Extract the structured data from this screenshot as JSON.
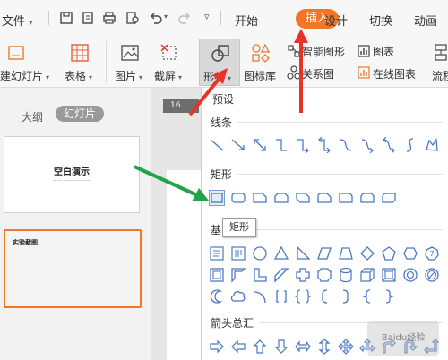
{
  "menubar": {
    "file_label": "文件",
    "tabs": [
      "开始",
      "插入",
      "设计",
      "切换",
      "动画"
    ],
    "active_tab": "插入"
  },
  "ribbon": {
    "new_slide_label": "建幻灯片",
    "table_label": "表格",
    "picture_label": "图片",
    "screenshot_label": "截屏",
    "shape_label": "形状",
    "icon_lib_label": "图标库",
    "smart_art_label": "智能图形",
    "relation_label": "关系图",
    "chart_label": "图表",
    "online_chart_label": "在线图表",
    "flowchart_label": "流程"
  },
  "left_panel": {
    "outline_tab": "大纲",
    "slides_tab": "幻灯片",
    "slide1_title": "空白演示",
    "slide2_title": "实验截图"
  },
  "canvas": {
    "ruler_badge": "16"
  },
  "shape_panel": {
    "title": "预设",
    "sections": {
      "lines": "线条",
      "rectangles": "矩形",
      "basic": "基",
      "arrows": "箭头总汇"
    },
    "tooltip": "矩形"
  },
  "watermark": "Baidu经验",
  "colors": {
    "accent": "#f07628",
    "red_arrow": "#e8322c",
    "green_arrow": "#22a34a",
    "shape_stroke": "#4a78c2"
  }
}
